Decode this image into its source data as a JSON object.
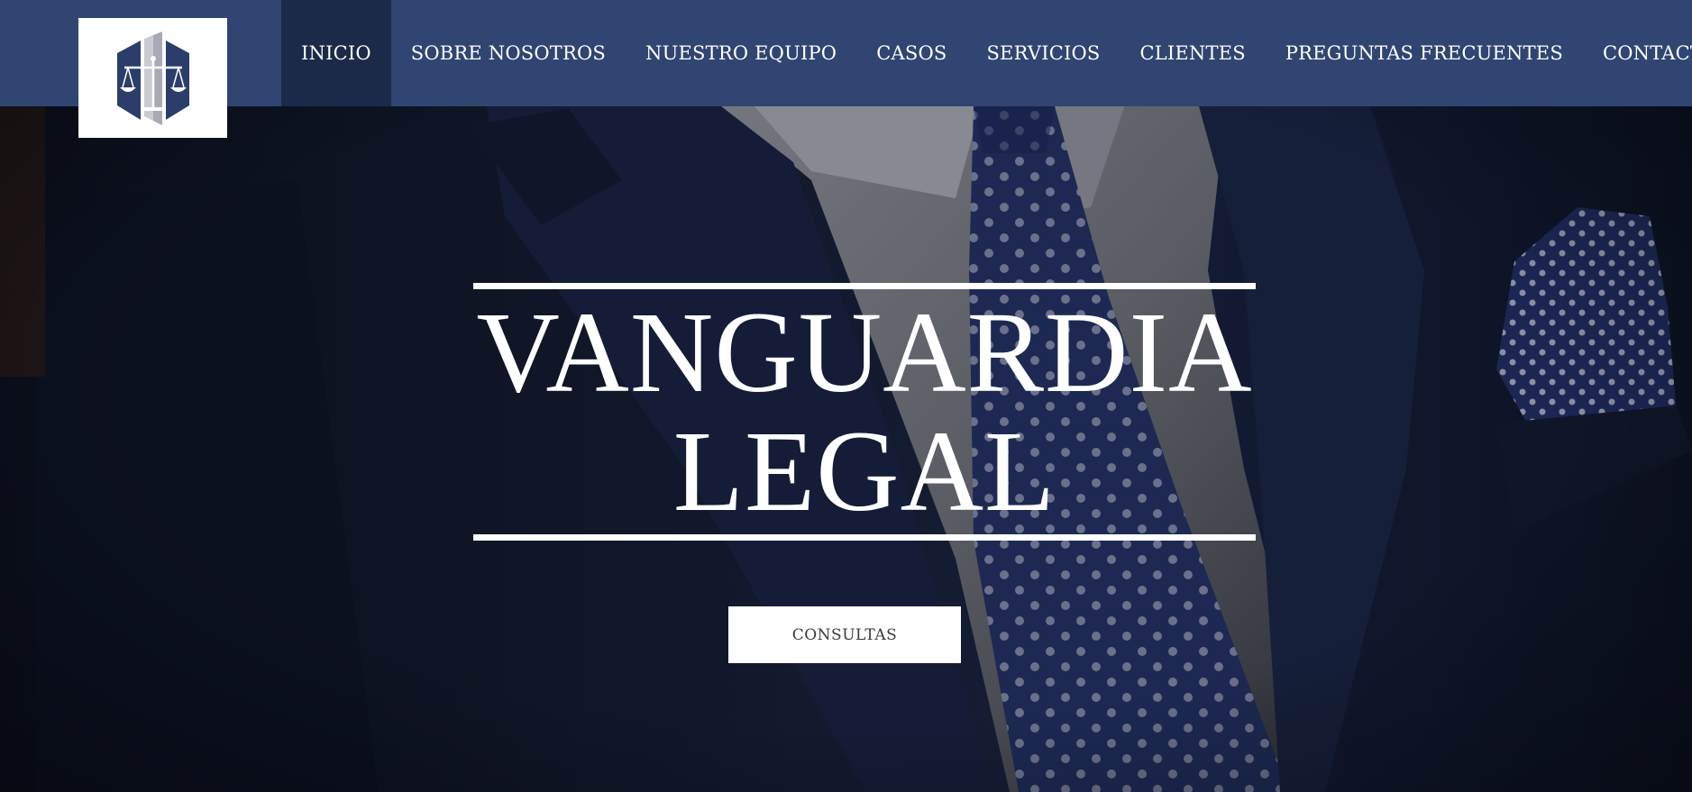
{
  "brand": {
    "logo_icon": "scales-of-justice-building-icon",
    "primary_color": "#304571",
    "active_nav_color": "#1c2a4a"
  },
  "nav": {
    "items": [
      {
        "label": "INICIO",
        "active": true
      },
      {
        "label": "SOBRE NOSOTROS",
        "active": false
      },
      {
        "label": "NUESTRO EQUIPO",
        "active": false
      },
      {
        "label": "CASOS",
        "active": false
      },
      {
        "label": "SERVICIOS",
        "active": false
      },
      {
        "label": "CLIENTES",
        "active": false
      },
      {
        "label": "PREGUNTAS FRECUENTES",
        "active": false
      },
      {
        "label": "CONTACTANOS",
        "active": false
      }
    ]
  },
  "hero": {
    "title_line_1": "VANGUARDIA",
    "title_line_2": "LEGAL",
    "cta_label": "CONSULTAS"
  }
}
